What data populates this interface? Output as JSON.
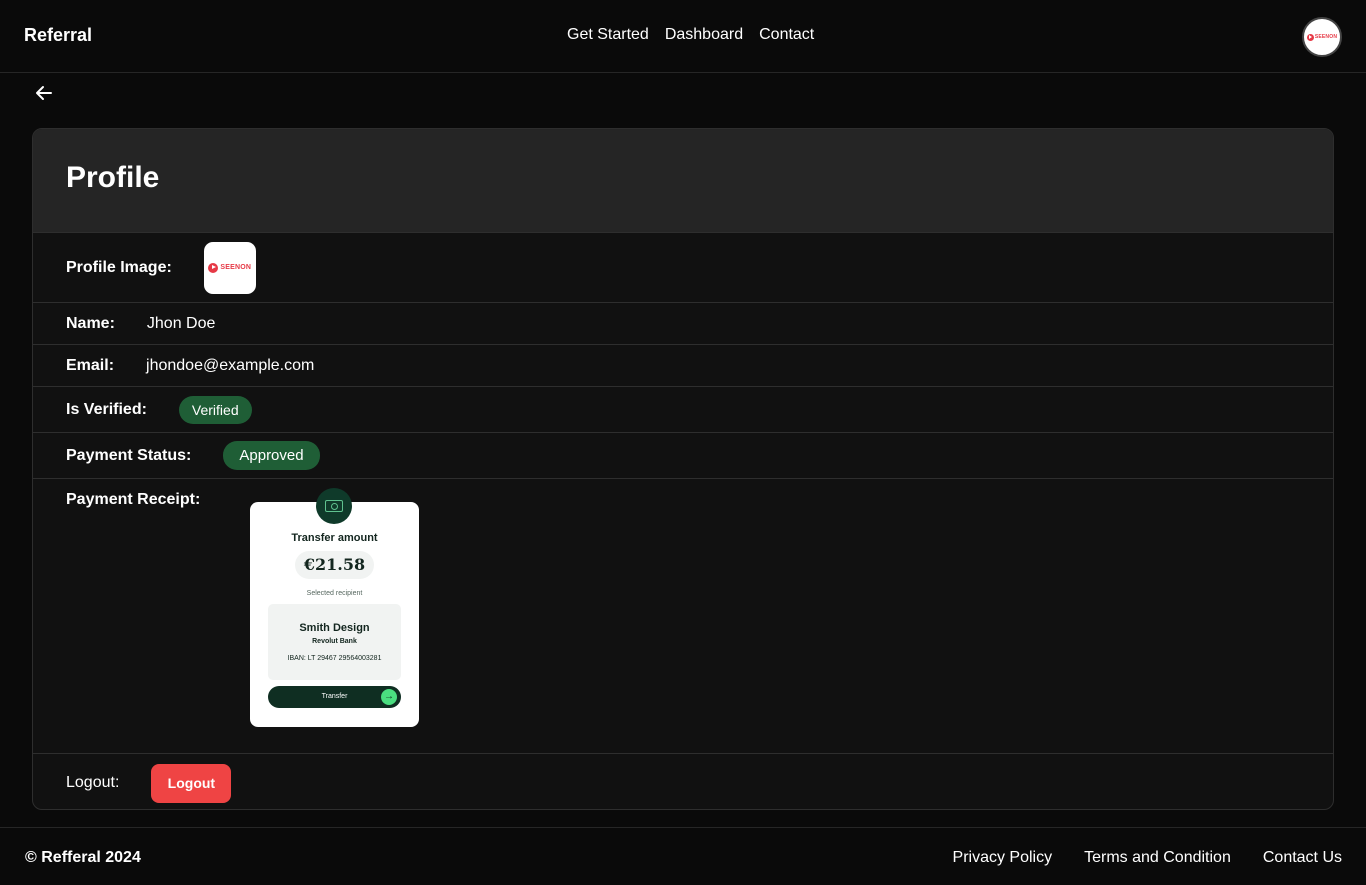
{
  "header": {
    "brand": "Referral",
    "nav": [
      "Get Started",
      "Dashboard",
      "Contact"
    ],
    "avatar_logo_text": "SEENON"
  },
  "profile": {
    "title": "Profile",
    "image_label": "Profile Image:",
    "image_logo_text": "SEENON",
    "name_label": "Name:",
    "name": "Jhon Doe",
    "email_label": "Email:",
    "email": "jhondoe@example.com",
    "verified_label": "Is Verified:",
    "verified_status": "Verified",
    "payment_label": "Payment Status:",
    "payment_status": "Approved",
    "receipt_label": "Payment Receipt:",
    "logout_label": "Logout:",
    "logout_button": "Logout"
  },
  "receipt": {
    "title": "Transfer amount",
    "amount": "€21.58",
    "selected": "Selected recipient",
    "recipient": "Smith Design",
    "bank": "Revolut Bank",
    "iban": "IBAN: LT 29467 29564003281",
    "button": "Transfer"
  },
  "footer": {
    "copyright": "© Refferal 2024",
    "links": [
      "Privacy Policy",
      "Terms and Condition",
      "Contact Us"
    ]
  },
  "colors": {
    "background": "#0a0a0a",
    "card_header": "#252525",
    "badge_green": "#1f5e36",
    "logout_red": "#ef4444"
  }
}
